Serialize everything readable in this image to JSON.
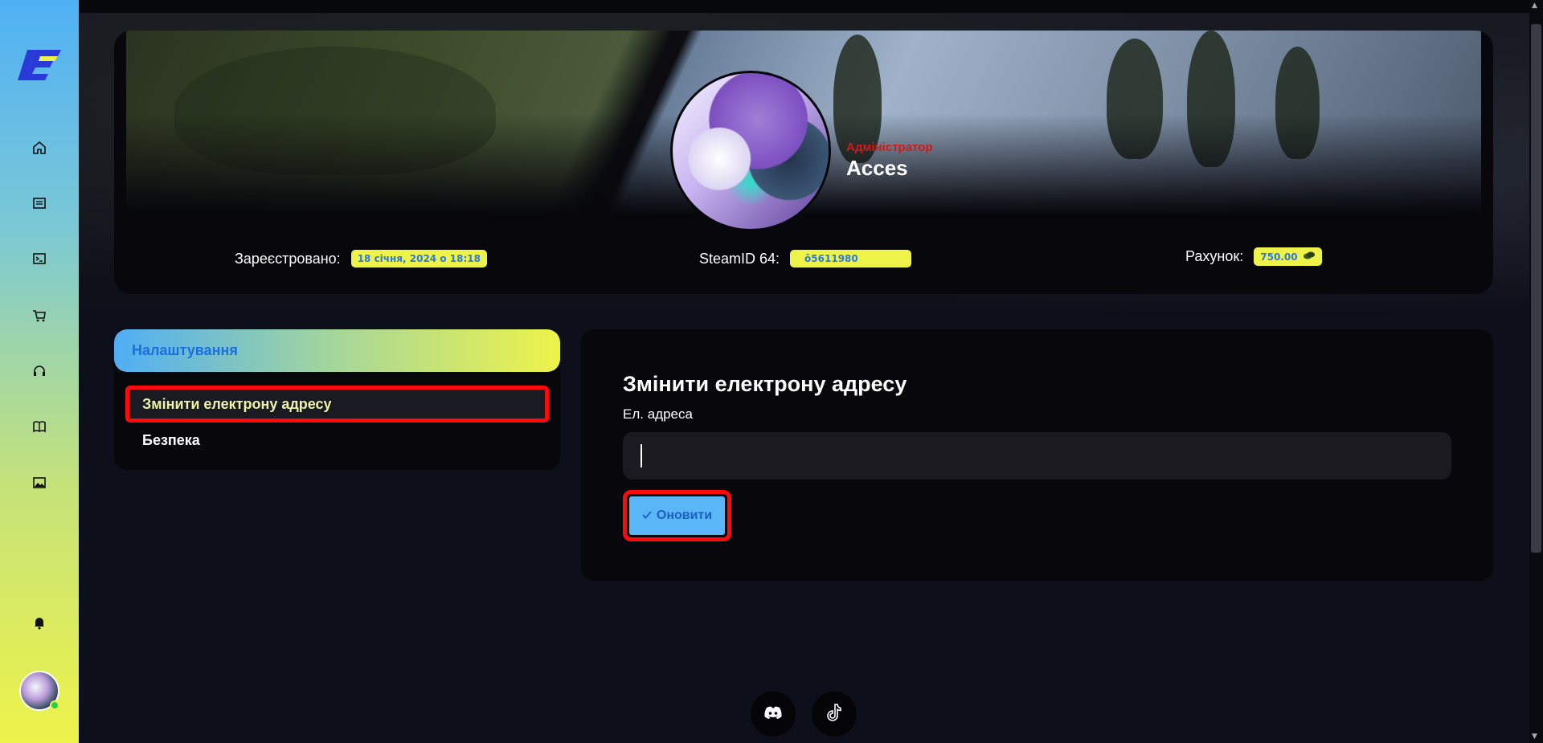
{
  "sidebar": {
    "nav": [
      {
        "icon": "home-icon"
      },
      {
        "icon": "news-icon"
      },
      {
        "icon": "terminal-icon"
      },
      {
        "icon": "cart-icon"
      },
      {
        "icon": "headset-icon"
      },
      {
        "icon": "book-icon"
      },
      {
        "icon": "gallery-icon"
      }
    ],
    "bell_icon": "bell-icon",
    "status": "online"
  },
  "profile": {
    "role": "Адміністратор",
    "username": "Acces",
    "registered_label": "Зареєстровано:",
    "registered_value": "18 січня, 2024 о 18:18",
    "steamid_label": "SteamID 64:",
    "steamid_value": "ô5611980",
    "balance_label": "Рахунок:",
    "balance_value": "750.00"
  },
  "settings_menu": {
    "title": "Налаштування",
    "items": [
      {
        "label": "Змінити електрону адресу",
        "active": true
      },
      {
        "label": "Безпека",
        "active": false
      }
    ]
  },
  "email_form": {
    "title": "Змінити електрону адресу",
    "field_label": "Ел. адреса",
    "field_value": "",
    "button_label": "Оновити"
  },
  "socials": [
    {
      "icon": "discord-icon"
    },
    {
      "icon": "tiktok-icon"
    }
  ],
  "colors": {
    "accent_blue": "#4faef5",
    "accent_yellow": "#eef34a",
    "highlight_red": "#ff0a0a",
    "role_red": "#d21a1a"
  }
}
